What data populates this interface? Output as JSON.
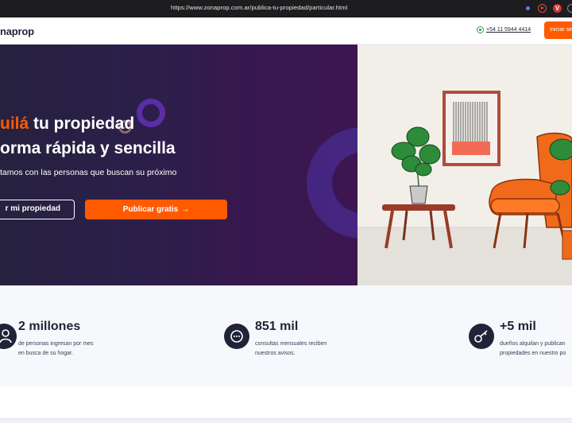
{
  "browser": {
    "url": "https://www.zonaprop.com.ar/publica-tu-propiedad/particular.html"
  },
  "header": {
    "logo": "naprop",
    "phone": "+54 11 5944 4414",
    "login_button": "Iniciar se"
  },
  "hero": {
    "title_accent": "uilá",
    "title_line1_rest": " tu propiedad",
    "title_line2": "orma rápida y sencilla",
    "subtitle": "tamos con las personas que buscan su próximo",
    "valuate_button": "r mi propiedad",
    "publish_button": "Publicar gratis",
    "publish_arrow": "→"
  },
  "stats": [
    {
      "number": "2 millones",
      "desc_line1": "de personas ingresan por mes",
      "desc_line2": "en busca de su hogar.",
      "icon": "people-icon"
    },
    {
      "number": "851 mil",
      "desc_line1": "consultas mensuales reciben",
      "desc_line2": "nuestros avisos.",
      "icon": "chat-icon"
    },
    {
      "number": "+5 mil",
      "desc_line1": "dueños alquilan y publican",
      "desc_line2": "propiedades en nuestro po",
      "icon": "key-icon"
    }
  ],
  "colors": {
    "accent": "#ff5a00",
    "navy": "#1f2438",
    "hero_bg": "#2b1f4a"
  }
}
